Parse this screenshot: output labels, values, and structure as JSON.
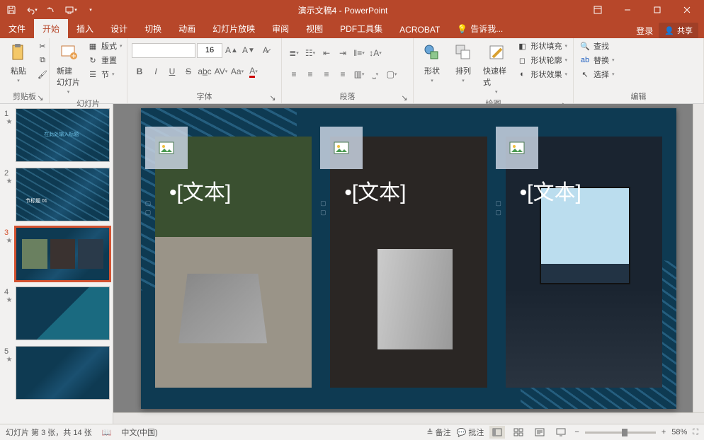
{
  "title": "演示文稿4 - PowerPoint",
  "tabs": {
    "file": "文件",
    "home": "开始",
    "insert": "插入",
    "design": "设计",
    "transitions": "切换",
    "animations": "动画",
    "slideshow": "幻灯片放映",
    "review": "审阅",
    "view": "视图",
    "pdftools": "PDF工具集",
    "acrobat": "ACROBAT",
    "tellme": "告诉我..."
  },
  "account": {
    "login": "登录",
    "share": "共享"
  },
  "ribbon": {
    "clipboard": {
      "label": "剪贴板",
      "paste": "粘贴"
    },
    "slides": {
      "label": "幻灯片",
      "newslide": "新建\n幻灯片",
      "layout": "版式",
      "reset": "重置",
      "section": "节"
    },
    "font": {
      "label": "字体",
      "size": "16"
    },
    "paragraph": {
      "label": "段落"
    },
    "drawing": {
      "label": "绘图",
      "shapes": "形状",
      "arrange": "排列",
      "quickstyles": "快速样式",
      "shapefill": "形状填充",
      "shapeoutline": "形状轮廓",
      "shapeeffects": "形状效果"
    },
    "editing": {
      "label": "编辑",
      "find": "查找",
      "replace": "替换",
      "select": "选择"
    }
  },
  "slide": {
    "text_placeholder": "[文本]"
  },
  "thumbs": {
    "t1_title": "在此处输入标题",
    "t2_title": "节标题 01"
  },
  "status": {
    "slide_info": "幻灯片 第 3 张，共 14 张",
    "lang": "中文(中国)",
    "notes": "备注",
    "comments": "批注",
    "zoom": "58%"
  }
}
